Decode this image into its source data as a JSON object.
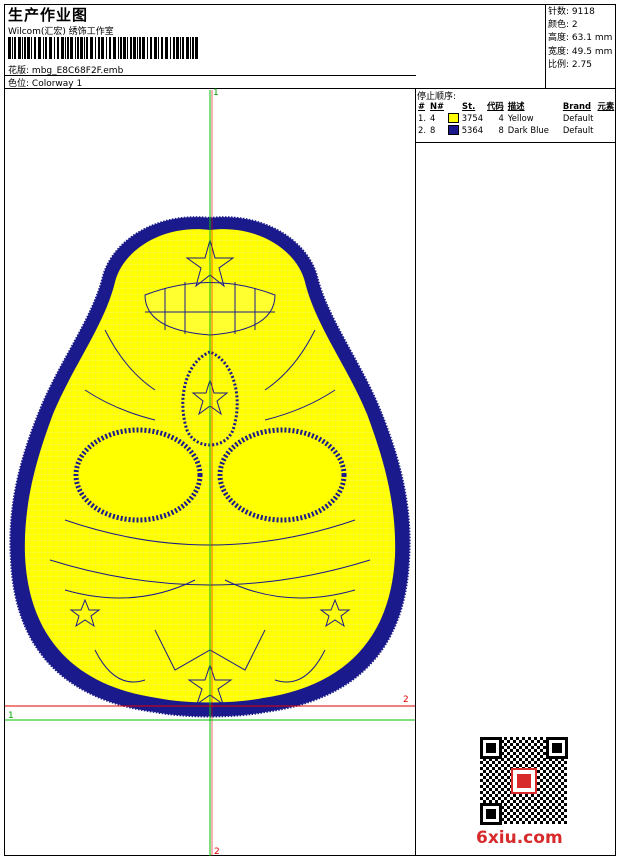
{
  "header": {
    "title": "生产作业图",
    "company": "Wilcom(汇宏) 绣饰工作室",
    "design_label": "花版:",
    "design_file": "mbg_E8C68F2F.emb",
    "colorway_label": "色位:",
    "colorway": "Colorway 1"
  },
  "stats": {
    "stitches_label": "针数:",
    "stitches": "9118",
    "colors_label": "颜色:",
    "colors": "2",
    "height_label": "高度:",
    "height": "63.1 mm",
    "width_label": "宽度:",
    "width": "49.5 mm",
    "scale_label": "比例:",
    "scale": "2.75"
  },
  "stop_sequence": {
    "title": "停止顺序:",
    "headers": [
      "#",
      "N#",
      "St.",
      "代码",
      "描述",
      "Brand",
      "元素"
    ],
    "rows": [
      {
        "idx": "1.",
        "n": "4",
        "code": "3754",
        "num": "4",
        "desc": "Yellow",
        "brand": "Default",
        "color": "#ffff00"
      },
      {
        "idx": "2.",
        "n": "8",
        "code": "5364",
        "num": "8",
        "desc": "Dark Blue",
        "brand": "Default",
        "color": "#1a1a8c"
      }
    ]
  },
  "axes": {
    "top_label": "1",
    "bottom_label": "2",
    "left_label": "1",
    "right_label": "2"
  },
  "watermark": "6xiu.com",
  "colors": {
    "fill": "#ffff00",
    "outline": "#1a1a8c",
    "axis_green": "#00c000",
    "axis_red": "#e00000"
  }
}
